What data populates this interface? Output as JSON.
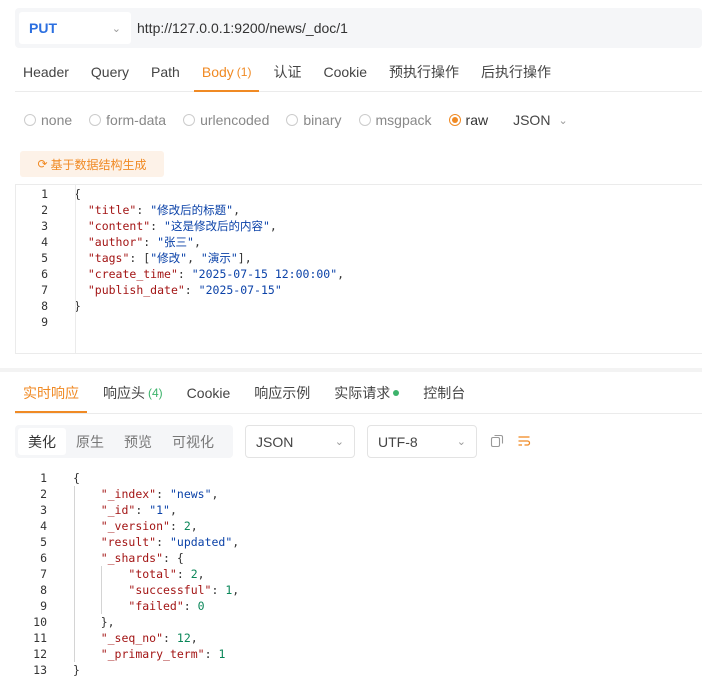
{
  "request": {
    "method": "PUT",
    "url": "http://127.0.0.1:9200/news/_doc/1",
    "tabs": [
      {
        "label": "Header",
        "count": ""
      },
      {
        "label": "Query",
        "count": ""
      },
      {
        "label": "Path",
        "count": ""
      },
      {
        "label": "Body",
        "count": "(1)"
      },
      {
        "label": "认证",
        "count": ""
      },
      {
        "label": "Cookie",
        "count": ""
      },
      {
        "label": "预执行操作",
        "count": ""
      },
      {
        "label": "后执行操作",
        "count": ""
      }
    ],
    "active_tab": "Body",
    "body_types": [
      "none",
      "form-data",
      "urlencoded",
      "binary",
      "msgpack",
      "raw"
    ],
    "selected_body_type": "raw",
    "format": "JSON",
    "generate_button": "基于数据结构生成",
    "body_lines": [
      "{",
      "  \"title\": \"修改后的标题\",",
      "  \"content\": \"这是修改后的内容\",",
      "  \"author\": \"张三\",",
      "  \"tags\": [\"修改\", \"演示\"],",
      "  \"create_time\": \"2025-07-15 12:00:00\",",
      "  \"publish_date\": \"2025-07-15\"",
      "}",
      ""
    ]
  },
  "response": {
    "tabs": [
      {
        "label": "实时响应",
        "count": ""
      },
      {
        "label": "响应头",
        "count": "(4)"
      },
      {
        "label": "Cookie",
        "count": ""
      },
      {
        "label": "响应示例",
        "count": ""
      },
      {
        "label": "实际请求",
        "count": ""
      },
      {
        "label": "控制台",
        "count": ""
      }
    ],
    "active_tab": "实时响应",
    "views": [
      "美化",
      "原生",
      "预览",
      "可视化"
    ],
    "active_view": "美化",
    "format": "JSON",
    "encoding": "UTF-8",
    "icons": [
      "copy-icon",
      "wrap-icon"
    ],
    "body_lines": [
      "{",
      "    \"_index\": \"news\",",
      "    \"_id\": \"1\",",
      "    \"_version\": 2,",
      "    \"result\": \"updated\",",
      "    \"_shards\": {",
      "        \"total\": 2,",
      "        \"successful\": 1,",
      "        \"failed\": 0",
      "    },",
      "    \"_seq_no\": 12,",
      "    \"_primary_term\": 1",
      "}"
    ]
  },
  "colors": {
    "accent": "#f08a24",
    "method": "#2b6fe0",
    "json_key": "#a31515",
    "json_string": "#0b42a8",
    "json_number": "#098658",
    "success": "#3db36b"
  }
}
